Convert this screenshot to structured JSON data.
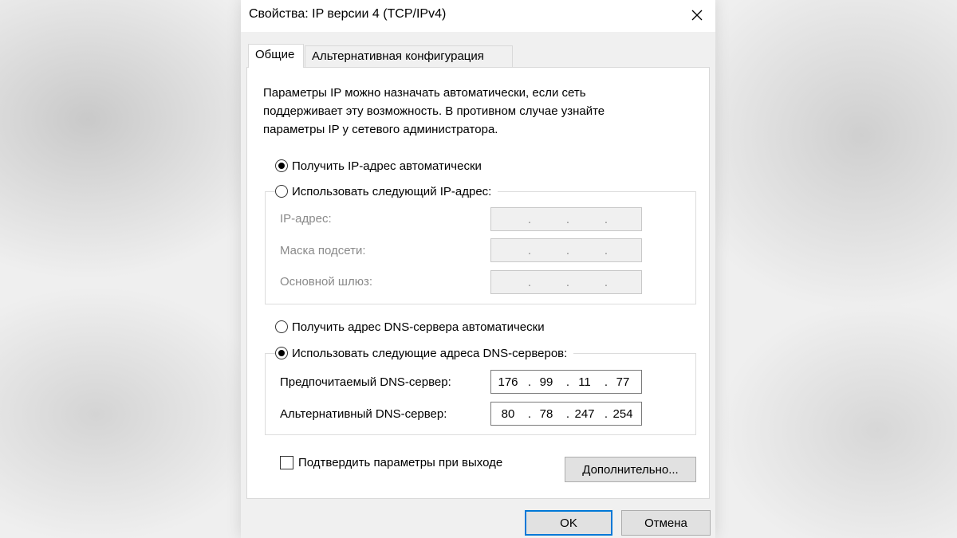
{
  "dialog": {
    "title": "Свойства: IP версии 4 (TCP/IPv4)",
    "close_icon": "close-icon"
  },
  "tabs": [
    {
      "label": "Общие",
      "active": true
    },
    {
      "label": "Альтернативная конфигурация",
      "active": false
    }
  ],
  "description": [
    "Параметры IP можно назначать автоматически, если сеть",
    "поддерживает эту возможность. В противном случае узнайте",
    "параметры IP у сетевого администратора."
  ],
  "ip": {
    "auto_label": "Получить IP-адрес автоматически",
    "auto_selected": true,
    "manual_label": "Использовать следующий IP-адрес:",
    "manual_selected": false,
    "address_label": "IP-адрес:",
    "mask_label": "Маска подсети:",
    "gateway_label": "Основной шлюз:",
    "address_value": [
      "",
      "",
      "",
      ""
    ],
    "mask_value": [
      "",
      "",
      "",
      ""
    ],
    "gateway_value": [
      "",
      "",
      "",
      ""
    ]
  },
  "dns": {
    "auto_label": "Получить адрес DNS-сервера автоматически",
    "auto_selected": false,
    "manual_label": "Использовать следующие адреса DNS-серверов:",
    "manual_selected": true,
    "preferred_label": "Предпочитаемый DNS-сервер:",
    "alternate_label": "Альтернативный DNS-сервер:",
    "preferred_value": [
      "176",
      "99",
      "11",
      "77"
    ],
    "alternate_value": [
      "80",
      "78",
      "247",
      "254"
    ]
  },
  "validate": {
    "label": "Подтвердить параметры при выходе",
    "checked": false
  },
  "buttons": {
    "advanced": "Дополнительно...",
    "ok": "OK",
    "cancel": "Отмена"
  },
  "colors": {
    "accent": "#0078d7",
    "disabled_text": "#8a8a8a"
  }
}
